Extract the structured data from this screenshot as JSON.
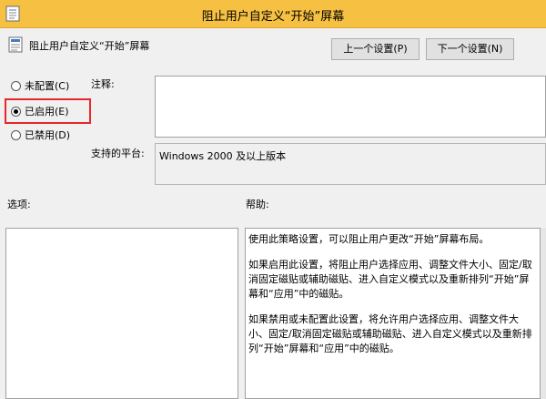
{
  "window": {
    "title": "阻止用户自定义“开始”屏幕"
  },
  "header": {
    "policy_name": "阻止用户自定义“开始”屏幕",
    "prev_button": "上一个设置(P)",
    "next_button": "下一个设置(N)"
  },
  "options": {
    "not_configured": "未配置(C)",
    "enabled": "已启用(E)",
    "disabled": "已禁用(D)",
    "selected": "enabled"
  },
  "comment": {
    "label": "注释:",
    "value": ""
  },
  "platform": {
    "label": "支持的平台:",
    "value": "Windows 2000 及以上版本"
  },
  "options_section": {
    "label": "选项:"
  },
  "help_section": {
    "label": "帮助:",
    "paragraphs": [
      "使用此策略设置，可以阻止用户更改“开始”屏幕布局。",
      "如果启用此设置，将阻止用户选择应用、调整文件大小、固定/取消固定磁贴或辅助磁贴、进入自定义模式以及重新排列“开始”屏幕和“应用”中的磁贴。",
      "如果禁用或未配置此设置，将允许用户选择应用、调整文件大小、固定/取消固定磁贴或辅助磁贴、进入自定义模式以及重新排列“开始”屏幕和“应用”中的磁贴。"
    ]
  },
  "colors": {
    "titlebar": "#f6c142",
    "highlight_border": "#e7272a"
  },
  "icons": {
    "app": "policy-document-icon",
    "policy": "policy-document-icon"
  }
}
